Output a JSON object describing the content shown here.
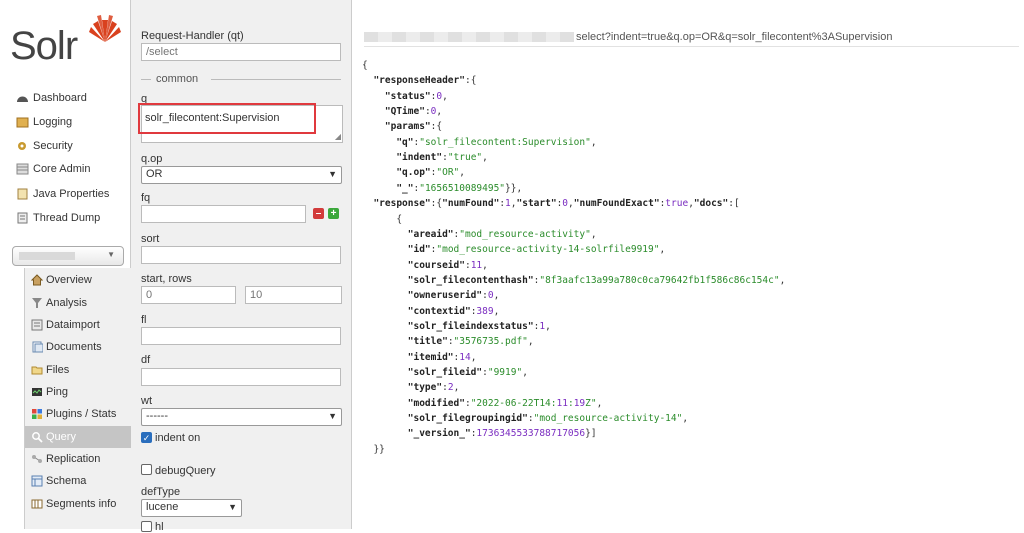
{
  "logo": {
    "text": "Solr"
  },
  "nav": [
    {
      "label": "Dashboard",
      "icon": "dashboard-icon"
    },
    {
      "label": "Logging",
      "icon": "logging-icon"
    },
    {
      "label": "Security",
      "icon": "security-icon"
    },
    {
      "label": "Core Admin",
      "icon": "core-admin-icon"
    },
    {
      "label": "Java Properties",
      "icon": "java-properties-icon"
    },
    {
      "label": "Thread Dump",
      "icon": "thread-dump-icon"
    }
  ],
  "core_selector": {
    "value": ""
  },
  "core_menu": [
    {
      "label": "Overview",
      "icon": "home-icon"
    },
    {
      "label": "Analysis",
      "icon": "funnel-icon"
    },
    {
      "label": "Dataimport",
      "icon": "dataimport-icon"
    },
    {
      "label": "Documents",
      "icon": "documents-icon"
    },
    {
      "label": "Files",
      "icon": "folder-icon"
    },
    {
      "label": "Ping",
      "icon": "ping-icon"
    },
    {
      "label": "Plugins / Stats",
      "icon": "plugins-icon"
    },
    {
      "label": "Query",
      "icon": "magnifier-icon",
      "active": true
    },
    {
      "label": "Replication",
      "icon": "replication-icon"
    },
    {
      "label": "Schema",
      "icon": "schema-icon"
    },
    {
      "label": "Segments info",
      "icon": "segments-icon"
    }
  ],
  "form": {
    "request_handler_label": "Request-Handler (qt)",
    "request_handler_placeholder": "/select",
    "common_label": "common",
    "q_label": "q",
    "q_value": "solr_filecontent:Supervision",
    "qop_label": "q.op",
    "qop_value": "OR",
    "fq_label": "fq",
    "fq_value": "",
    "sort_label": "sort",
    "sort_value": "",
    "start_rows_label": "start, rows",
    "start_placeholder": "0",
    "rows_placeholder": "10",
    "fl_label": "fl",
    "df_label": "df",
    "wt_label": "wt",
    "wt_value": "------",
    "indent_label": "indent on",
    "indent_checked": true,
    "debug_label": "debugQuery",
    "debug_checked": false,
    "deftype_label": "defType",
    "deftype_value": "lucene",
    "hl_label": "hl"
  },
  "response": {
    "url_tail": "select?indent=true&q.op=OR&q=solr_filecontent%3ASupervision",
    "lines": [
      "{",
      "  \"responseHeader\":{",
      "    \"status\":0,",
      "    \"QTime\":0,",
      "    \"params\":{",
      "      \"q\":\"solr_filecontent:Supervision\",",
      "      \"indent\":\"true\",",
      "      \"q.op\":\"OR\",",
      "      \"_\":\"1656510089495\"}},",
      "  \"response\":{\"numFound\":1,\"start\":0,\"numFoundExact\":true,\"docs\":[",
      "      {",
      "        \"areaid\":\"mod_resource-activity\",",
      "        \"id\":\"mod_resource-activity-14-solrfile9919\",",
      "        \"courseid\":11,",
      "        \"solr_filecontenthash\":\"8f3aafc13a99a780c0ca79642fb1f586c86c154c\",",
      "        \"owneruserid\":0,",
      "        \"contextid\":389,",
      "        \"solr_fileindexstatus\":1,",
      "        \"title\":\"3576735.pdf\",",
      "        \"itemid\":14,",
      "        \"solr_fileid\":\"9919\",",
      "        \"type\":2,",
      "        \"modified\":\"2022-06-22T14:11:19Z\",",
      "        \"solr_filegroupingid\":\"mod_resource-activity-14\",",
      "        \"_version_\":1736345533788717056}]",
      "  }}"
    ]
  },
  "colors": {
    "accent_red": "#e0393e",
    "string_green": "#2b8c2b",
    "number_purple": "#7a2dc0"
  }
}
